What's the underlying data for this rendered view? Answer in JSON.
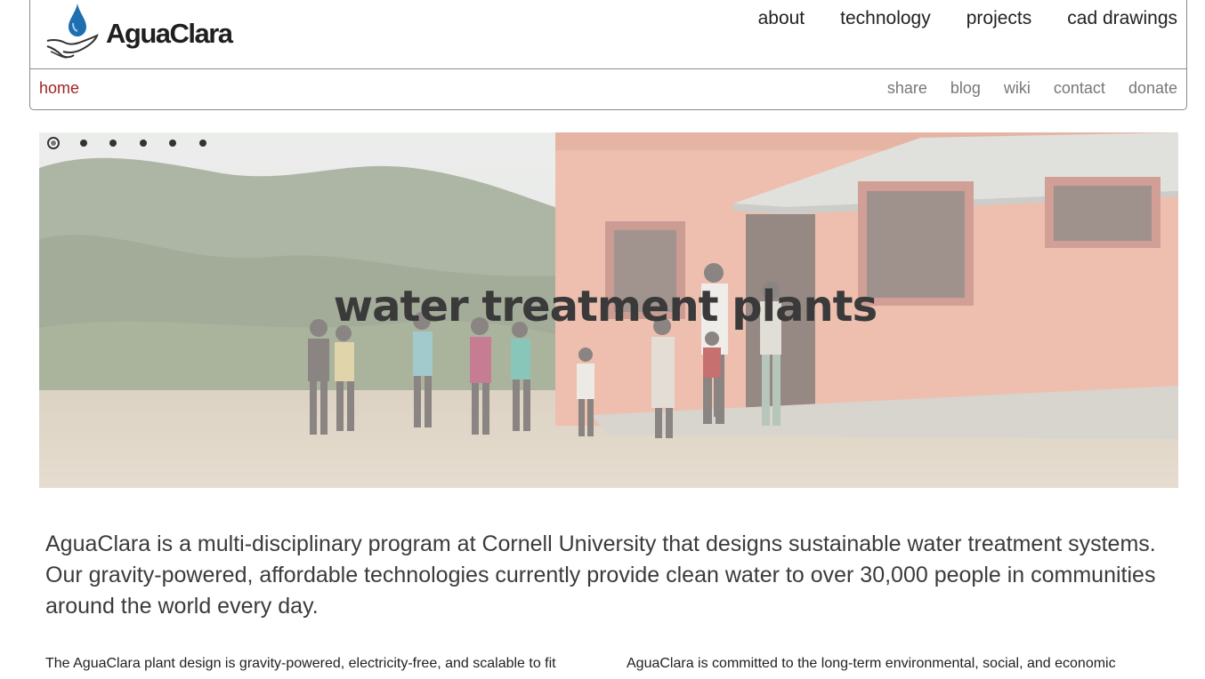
{
  "header": {
    "logo_text": "AguaClara",
    "main_nav": [
      "about",
      "technology",
      "projects",
      "cad drawings"
    ],
    "home_label": "home",
    "sub_nav": [
      "share",
      "blog",
      "wiki",
      "contact",
      "donate"
    ]
  },
  "hero": {
    "title": "water treatment plants",
    "slide_count": 6,
    "active_slide": 1
  },
  "content": {
    "intro": "AguaClara is a multi-disciplinary program at Cornell University that designs sustainable water treatment systems. Our gravity-powered, affordable technologies currently provide clean water to over 30,000 people in communities around the world every day.",
    "left_column": "The AguaClara plant design is gravity-powered, electricity-free, and scalable to fit",
    "right_column": "AguaClara is committed to the long-term environmental, social, and economic"
  },
  "colors": {
    "accent_red": "#a42424",
    "logo_blue": "#1f6fb0",
    "nav_text": "#222222",
    "sub_nav_text": "#777777",
    "body_text": "#3b3b3b"
  }
}
